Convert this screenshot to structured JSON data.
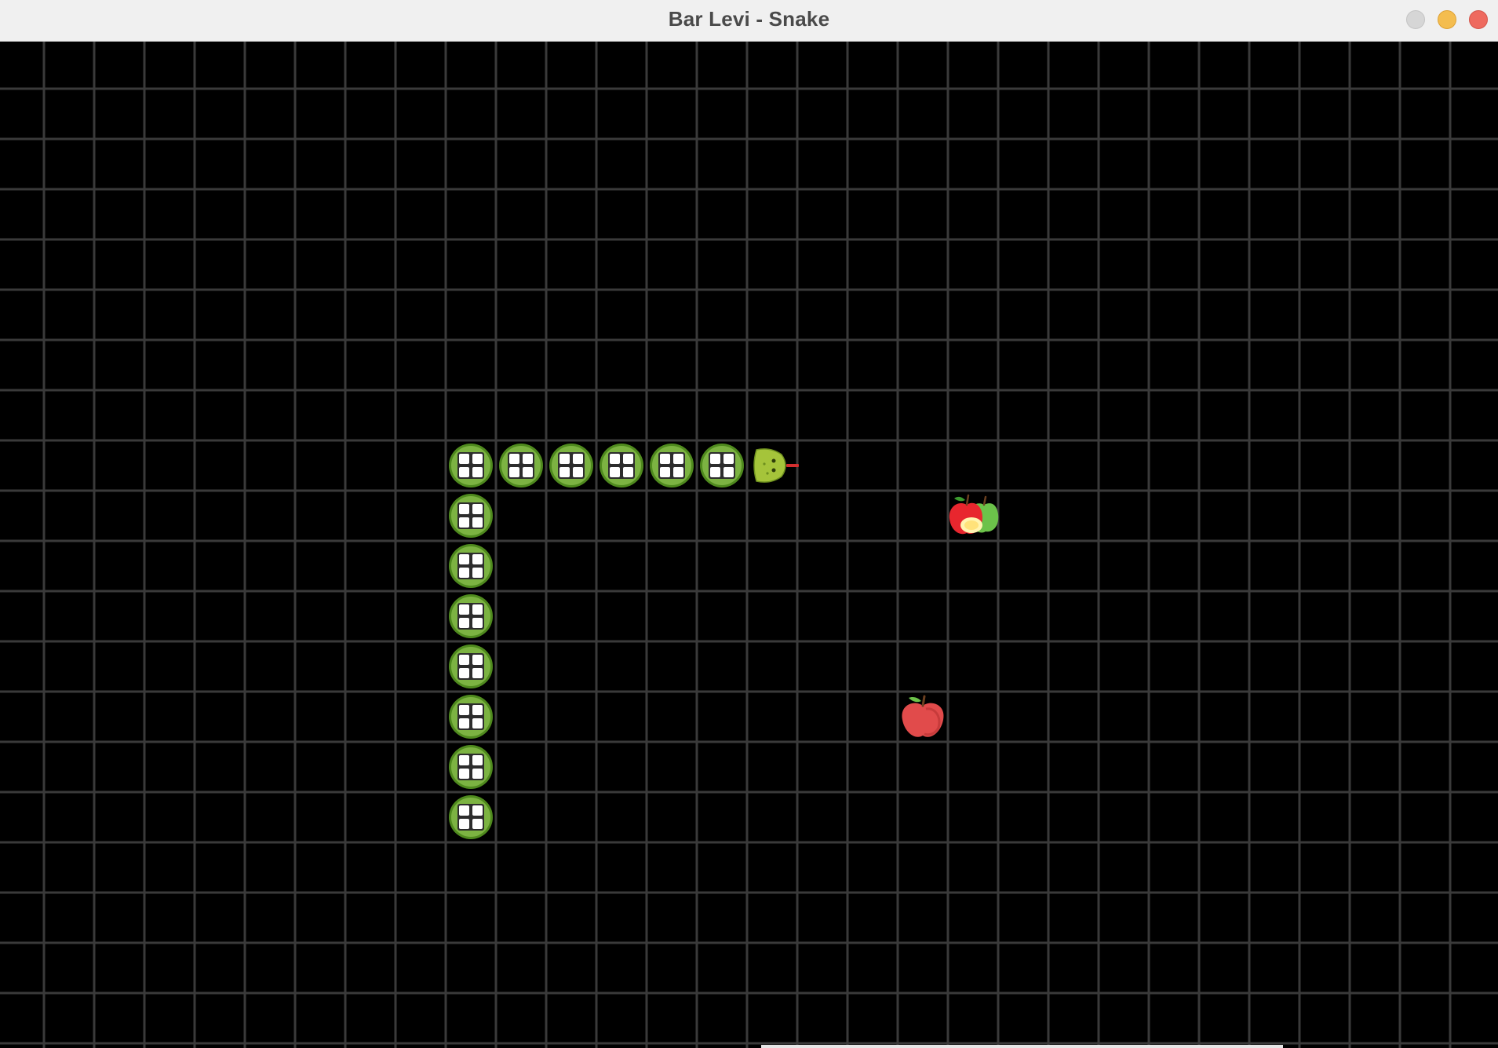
{
  "window": {
    "title": "Bar Levi - Snake",
    "controls": [
      "gray-button",
      "minimize-button",
      "close-button"
    ]
  },
  "colors": {
    "board_background": "#000000",
    "grid_line": "#3a3a3a",
    "segment_fill": "#7cb342",
    "segment_ring": "#4f8a1e",
    "segment_window": "#ffffff",
    "segment_frame": "#2d2d2d",
    "head_fill": "#a5c43a",
    "tongue": "#d32f2f",
    "apple_red": "#e14b4b",
    "apple_green": "#6cc24a"
  },
  "board": {
    "columns": 30,
    "rows": 20,
    "snake": {
      "head": {
        "col": 15,
        "row": 8,
        "direction": "right",
        "icon": "snake-head-icon"
      },
      "body": [
        {
          "col": 14,
          "row": 8
        },
        {
          "col": 13,
          "row": 8
        },
        {
          "col": 12,
          "row": 8
        },
        {
          "col": 11,
          "row": 8
        },
        {
          "col": 10,
          "row": 8
        },
        {
          "col": 9,
          "row": 8
        },
        {
          "col": 9,
          "row": 9
        },
        {
          "col": 9,
          "row": 10
        },
        {
          "col": 9,
          "row": 11
        },
        {
          "col": 9,
          "row": 12
        },
        {
          "col": 9,
          "row": 13
        },
        {
          "col": 9,
          "row": 14
        },
        {
          "col": 9,
          "row": 15
        }
      ]
    },
    "fruits": [
      {
        "kind": "apple-pair",
        "col": 19,
        "row": 9,
        "icon": "apple-pair-icon"
      },
      {
        "kind": "red-apple",
        "col": 18,
        "row": 13,
        "icon": "red-apple-icon"
      }
    ]
  }
}
